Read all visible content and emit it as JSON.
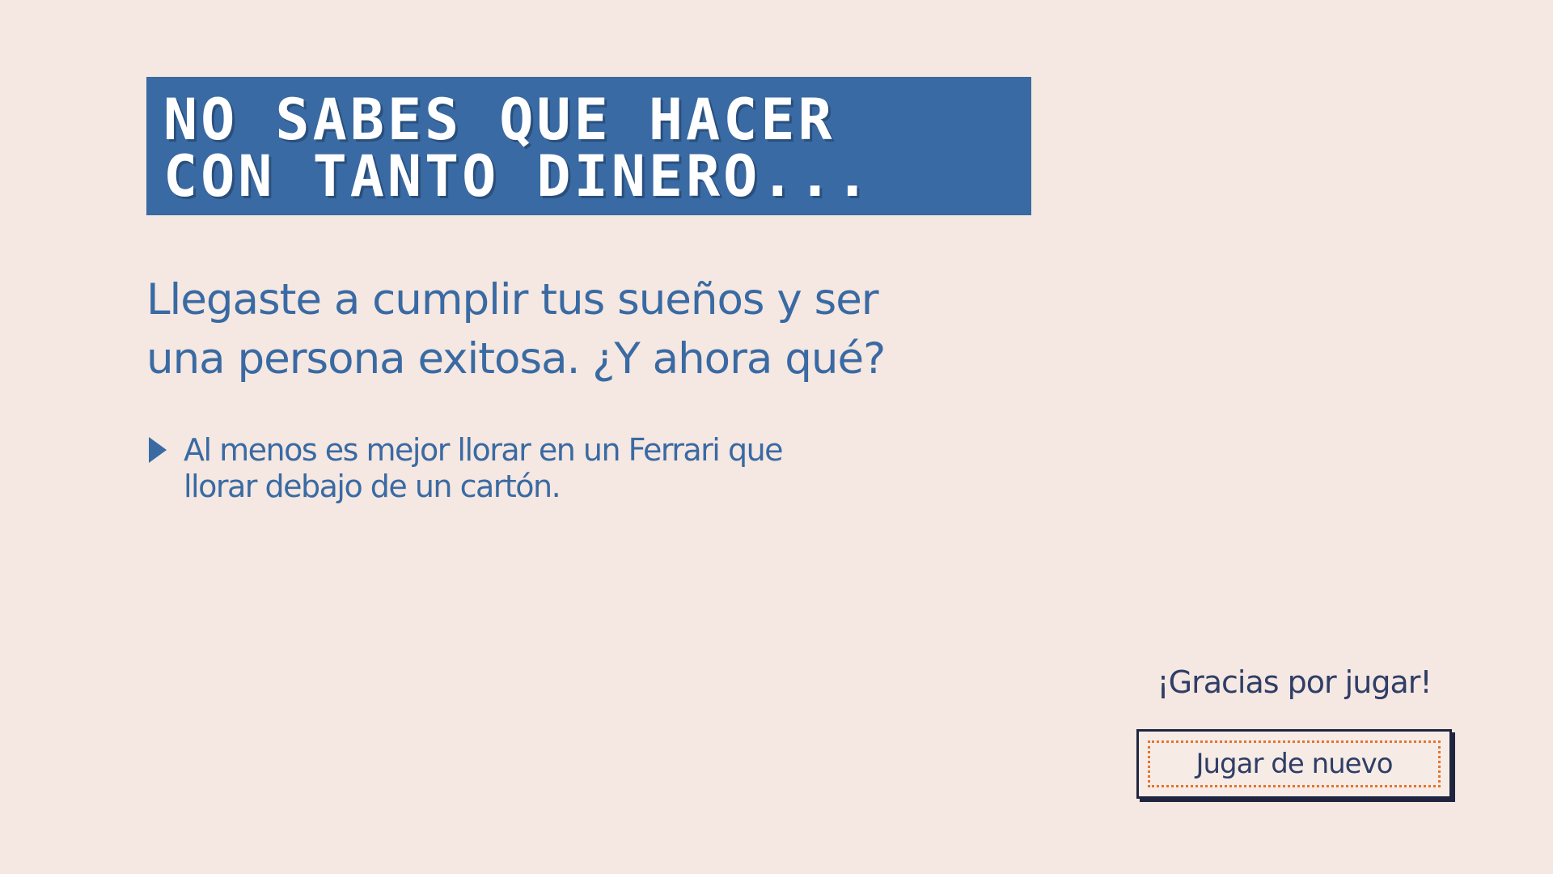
{
  "title": {
    "line1": "NO SABES QUE HACER",
    "line2": "CON TANTO DINERO..."
  },
  "lead": {
    "line1": "Llegaste a cumplir tus sueños y ser",
    "line2": "una persona exitosa. ¿Y ahora qué?"
  },
  "note": {
    "icon": "play-triangle-icon",
    "line1": "Al menos es mejor llorar en un Ferrari que",
    "line2": "llorar debajo de un cartón."
  },
  "thanks": "¡Gracias por jugar!",
  "replay_button": {
    "label": "Jugar de nuevo"
  },
  "colors": {
    "background": "#f5e7e1",
    "accent_blue": "#396aa3",
    "dark_navy": "#20253f",
    "focus_orange": "#e2752f"
  }
}
